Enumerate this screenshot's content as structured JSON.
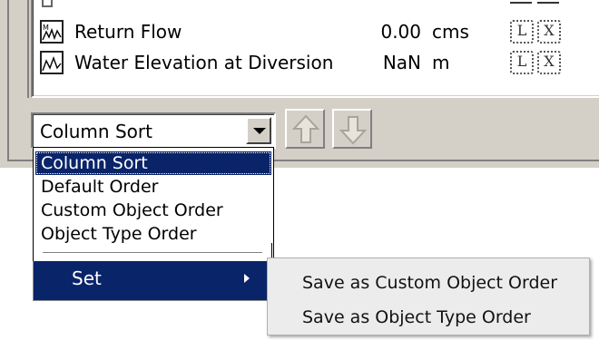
{
  "list": {
    "rows": [
      {
        "name": "Return Flow",
        "value": "0.00",
        "unit": "cms",
        "btn1": "L",
        "btn2": "X"
      },
      {
        "name": "Water Elevation at Diversion",
        "value": "NaN",
        "unit": "m",
        "btn1": "L",
        "btn2": "X"
      }
    ]
  },
  "sort": {
    "selected": "Column Sort",
    "options": [
      "Column Sort",
      "Default Order",
      "Custom Object Order",
      "Object Type Order"
    ]
  },
  "menu": {
    "set_label": "Set",
    "submenu": [
      "Save as Custom Object Order",
      "Save as Object Type Order"
    ]
  },
  "colors": {
    "highlight": "#0a246a",
    "panel": "#d4d0c8"
  }
}
